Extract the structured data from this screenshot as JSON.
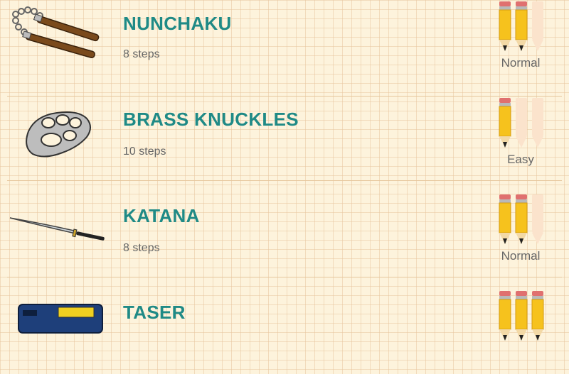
{
  "items": [
    {
      "name": "NUNCHAKU",
      "steps": "8 steps",
      "difficulty": "Normal",
      "level": 2,
      "icon": "nunchaku-icon"
    },
    {
      "name": "BRASS KNUCKLES",
      "steps": "10 steps",
      "difficulty": "Easy",
      "level": 1,
      "icon": "brass-knuckles-icon"
    },
    {
      "name": "KATANA",
      "steps": "8 steps",
      "difficulty": "Normal",
      "level": 2,
      "icon": "katana-icon"
    },
    {
      "name": "TASER",
      "steps": "",
      "difficulty": "",
      "level": 3,
      "icon": "taser-icon"
    }
  ],
  "max_level": 3,
  "colors": {
    "title": "#1f8a86",
    "pencil_body": "#f6c21d",
    "pencil_eraser": "#e0706f",
    "pencil_inactive": "#fbe3cc"
  }
}
